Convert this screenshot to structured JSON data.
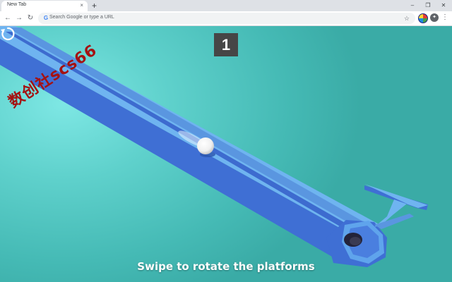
{
  "browser": {
    "tab_title": "New Tab",
    "tab_close": "×",
    "new_tab": "+",
    "window_controls": {
      "minimize": "–",
      "restore": "❐",
      "close": "✕"
    },
    "nav": {
      "back": "←",
      "forward": "→",
      "reload": "↻"
    },
    "omnibox": {
      "google_glyph": "G",
      "placeholder": "Search Google or type a URL"
    },
    "bookmark_star": "☆",
    "menu": "⋮",
    "extension_puzzle": "✦"
  },
  "game": {
    "score": "1",
    "watermark": "数创社scs66",
    "instruction": "Swipe to rotate the platforms",
    "restart_icon": "restart-arrow",
    "colors": {
      "background": "#5fd1cc",
      "track_top": "#6fb4f0",
      "track_side": "#3f6fd4",
      "track_dark": "#2f55b0",
      "ball": "#ffffff",
      "score_bg": "#464646",
      "watermark": "#a51212"
    }
  }
}
